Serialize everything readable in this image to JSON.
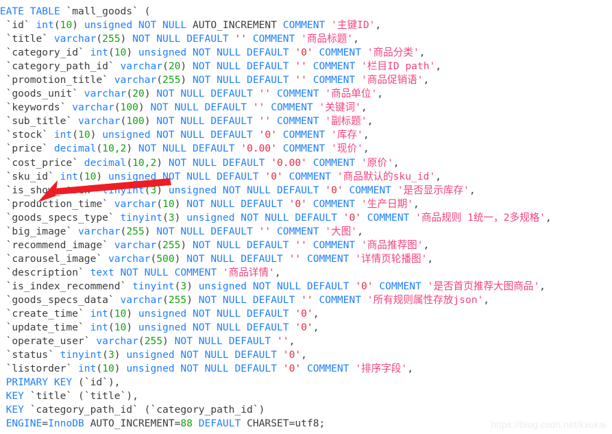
{
  "document": {
    "kind": "sql-create-table-dump",
    "table_name": "mall_goods",
    "watermark": "https://blog.csdn.net/kxukai",
    "engine": "InnoDB",
    "auto_increment": "88",
    "charset": "utf8"
  },
  "colors": {
    "keyword": "#1f7ffd",
    "identifier": "#3c3c3c",
    "number": "#13a10e",
    "string": "#e8283f",
    "comment_string": "#f4437d",
    "annotation_arrow": "#ee1c25",
    "background": "#ffffff",
    "watermark": "#ededed"
  },
  "annotation": {
    "type": "arrow",
    "points_at": "sku_id",
    "color": "#ee1c25"
  },
  "lines": [
    [
      {
        "t": "REATE TABLE ",
        "c": "kw"
      },
      {
        "t": "`mall_goods`",
        "c": "id"
      },
      {
        "t": " (",
        "c": "punc"
      }
    ],
    [
      {
        "t": "  `id`",
        "c": "id"
      },
      {
        "t": " int",
        "c": "typ"
      },
      {
        "t": "(",
        "c": "punc"
      },
      {
        "t": "10",
        "c": "num"
      },
      {
        "t": ")",
        "c": "punc"
      },
      {
        "t": " unsigned NOT NULL ",
        "c": "kw"
      },
      {
        "t": "AUTO_INCREMENT",
        "c": "plain"
      },
      {
        "t": " COMMENT ",
        "c": "kw"
      },
      {
        "t": "'主键ID'",
        "c": "cmt"
      },
      {
        "t": ",",
        "c": "punc"
      }
    ],
    [
      {
        "t": "  `title`",
        "c": "id"
      },
      {
        "t": " varchar",
        "c": "typ"
      },
      {
        "t": "(",
        "c": "punc"
      },
      {
        "t": "255",
        "c": "num"
      },
      {
        "t": ")",
        "c": "punc"
      },
      {
        "t": " NOT NULL DEFAULT ",
        "c": "kw"
      },
      {
        "t": "''",
        "c": "str"
      },
      {
        "t": " COMMENT ",
        "c": "kw"
      },
      {
        "t": "'商品标题'",
        "c": "cmt"
      },
      {
        "t": ",",
        "c": "punc"
      }
    ],
    [
      {
        "t": "  `category_id`",
        "c": "id"
      },
      {
        "t": " int",
        "c": "typ"
      },
      {
        "t": "(",
        "c": "punc"
      },
      {
        "t": "10",
        "c": "num"
      },
      {
        "t": ")",
        "c": "punc"
      },
      {
        "t": " unsigned NOT NULL DEFAULT ",
        "c": "kw"
      },
      {
        "t": "'0'",
        "c": "str"
      },
      {
        "t": " COMMENT ",
        "c": "kw"
      },
      {
        "t": "'商品分类'",
        "c": "cmt"
      },
      {
        "t": ",",
        "c": "punc"
      }
    ],
    [
      {
        "t": "  `category_path_id`",
        "c": "id"
      },
      {
        "t": " varchar",
        "c": "typ"
      },
      {
        "t": "(",
        "c": "punc"
      },
      {
        "t": "20",
        "c": "num"
      },
      {
        "t": ")",
        "c": "punc"
      },
      {
        "t": " NOT NULL DEFAULT ",
        "c": "kw"
      },
      {
        "t": "''",
        "c": "str"
      },
      {
        "t": " COMMENT ",
        "c": "kw"
      },
      {
        "t": "'栏目ID path'",
        "c": "cmt"
      },
      {
        "t": ",",
        "c": "punc"
      }
    ],
    [
      {
        "t": "  `promotion_title`",
        "c": "id"
      },
      {
        "t": " varchar",
        "c": "typ"
      },
      {
        "t": "(",
        "c": "punc"
      },
      {
        "t": "255",
        "c": "num"
      },
      {
        "t": ")",
        "c": "punc"
      },
      {
        "t": " NOT NULL DEFAULT ",
        "c": "kw"
      },
      {
        "t": "''",
        "c": "str"
      },
      {
        "t": " COMMENT ",
        "c": "kw"
      },
      {
        "t": "'商品促销语'",
        "c": "cmt"
      },
      {
        "t": ",",
        "c": "punc"
      }
    ],
    [
      {
        "t": "  `goods_unit`",
        "c": "id"
      },
      {
        "t": " varchar",
        "c": "typ"
      },
      {
        "t": "(",
        "c": "punc"
      },
      {
        "t": "20",
        "c": "num"
      },
      {
        "t": ")",
        "c": "punc"
      },
      {
        "t": " NOT NULL DEFAULT ",
        "c": "kw"
      },
      {
        "t": "''",
        "c": "str"
      },
      {
        "t": " COMMENT ",
        "c": "kw"
      },
      {
        "t": "'商品单位'",
        "c": "cmt"
      },
      {
        "t": ",",
        "c": "punc"
      }
    ],
    [
      {
        "t": "  `keywords`",
        "c": "id"
      },
      {
        "t": " varchar",
        "c": "typ"
      },
      {
        "t": "(",
        "c": "punc"
      },
      {
        "t": "100",
        "c": "num"
      },
      {
        "t": ")",
        "c": "punc"
      },
      {
        "t": " NOT NULL DEFAULT ",
        "c": "kw"
      },
      {
        "t": "''",
        "c": "str"
      },
      {
        "t": " COMMENT ",
        "c": "kw"
      },
      {
        "t": "'关键词'",
        "c": "cmt"
      },
      {
        "t": ",",
        "c": "punc"
      }
    ],
    [
      {
        "t": "  `sub_title`",
        "c": "id"
      },
      {
        "t": " varchar",
        "c": "typ"
      },
      {
        "t": "(",
        "c": "punc"
      },
      {
        "t": "100",
        "c": "num"
      },
      {
        "t": ")",
        "c": "punc"
      },
      {
        "t": " NOT NULL DEFAULT ",
        "c": "kw"
      },
      {
        "t": "''",
        "c": "str"
      },
      {
        "t": " COMMENT ",
        "c": "kw"
      },
      {
        "t": "'副标题'",
        "c": "cmt"
      },
      {
        "t": ",",
        "c": "punc"
      }
    ],
    [
      {
        "t": "  `stock`",
        "c": "id"
      },
      {
        "t": " int",
        "c": "typ"
      },
      {
        "t": "(",
        "c": "punc"
      },
      {
        "t": "10",
        "c": "num"
      },
      {
        "t": ")",
        "c": "punc"
      },
      {
        "t": " unsigned NOT NULL DEFAULT ",
        "c": "kw"
      },
      {
        "t": "'0'",
        "c": "str"
      },
      {
        "t": " COMMENT ",
        "c": "kw"
      },
      {
        "t": "'库存'",
        "c": "cmt"
      },
      {
        "t": ",",
        "c": "punc"
      }
    ],
    [
      {
        "t": "  `price`",
        "c": "id"
      },
      {
        "t": " decimal",
        "c": "typ"
      },
      {
        "t": "(",
        "c": "punc"
      },
      {
        "t": "10,2",
        "c": "num"
      },
      {
        "t": ")",
        "c": "punc"
      },
      {
        "t": " NOT NULL DEFAULT ",
        "c": "kw"
      },
      {
        "t": "'0.00'",
        "c": "str"
      },
      {
        "t": " COMMENT ",
        "c": "kw"
      },
      {
        "t": "'现价'",
        "c": "cmt"
      },
      {
        "t": ",",
        "c": "punc"
      }
    ],
    [
      {
        "t": "  `cost_price`",
        "c": "id"
      },
      {
        "t": " decimal",
        "c": "typ"
      },
      {
        "t": "(",
        "c": "punc"
      },
      {
        "t": "10,2",
        "c": "num"
      },
      {
        "t": ")",
        "c": "punc"
      },
      {
        "t": " NOT NULL DEFAULT ",
        "c": "kw"
      },
      {
        "t": "'0.00'",
        "c": "str"
      },
      {
        "t": " COMMENT ",
        "c": "kw"
      },
      {
        "t": "'原价'",
        "c": "cmt"
      },
      {
        "t": ",",
        "c": "punc"
      }
    ],
    [
      {
        "t": "  `sku_id`",
        "c": "id"
      },
      {
        "t": " int",
        "c": "typ"
      },
      {
        "t": "(",
        "c": "punc"
      },
      {
        "t": "10",
        "c": "num"
      },
      {
        "t": ")",
        "c": "punc"
      },
      {
        "t": " unsigned NOT NULL DEFAULT ",
        "c": "kw"
      },
      {
        "t": "'0'",
        "c": "str"
      },
      {
        "t": " COMMENT ",
        "c": "kw"
      },
      {
        "t": "'商品默认的sku_id'",
        "c": "cmt"
      },
      {
        "t": ",",
        "c": "punc"
      }
    ],
    [
      {
        "t": "  `is_show_stock`",
        "c": "id"
      },
      {
        "t": " tinyint",
        "c": "typ"
      },
      {
        "t": "(",
        "c": "punc"
      },
      {
        "t": "3",
        "c": "num"
      },
      {
        "t": ")",
        "c": "punc"
      },
      {
        "t": " unsigned NOT NULL DEFAULT ",
        "c": "kw"
      },
      {
        "t": "'0'",
        "c": "str"
      },
      {
        "t": " COMMENT ",
        "c": "kw"
      },
      {
        "t": "'是否显示库存'",
        "c": "cmt"
      },
      {
        "t": ",",
        "c": "punc"
      }
    ],
    [
      {
        "t": "  `production_time`",
        "c": "id"
      },
      {
        "t": " varchar",
        "c": "typ"
      },
      {
        "t": "(",
        "c": "punc"
      },
      {
        "t": "10",
        "c": "num"
      },
      {
        "t": ")",
        "c": "punc"
      },
      {
        "t": " NOT NULL DEFAULT ",
        "c": "kw"
      },
      {
        "t": "'0'",
        "c": "str"
      },
      {
        "t": " COMMENT ",
        "c": "kw"
      },
      {
        "t": "'生产日期'",
        "c": "cmt"
      },
      {
        "t": ",",
        "c": "punc"
      }
    ],
    [
      {
        "t": "  `goods_specs_type`",
        "c": "id"
      },
      {
        "t": " tinyint",
        "c": "typ"
      },
      {
        "t": "(",
        "c": "punc"
      },
      {
        "t": "3",
        "c": "num"
      },
      {
        "t": ")",
        "c": "punc"
      },
      {
        "t": " unsigned NOT NULL DEFAULT ",
        "c": "kw"
      },
      {
        "t": "'0'",
        "c": "str"
      },
      {
        "t": " COMMENT ",
        "c": "kw"
      },
      {
        "t": "'商品规则 1统一，2多规格'",
        "c": "cmt"
      },
      {
        "t": ",",
        "c": "punc"
      }
    ],
    [
      {
        "t": "  `big_image`",
        "c": "id"
      },
      {
        "t": " varchar",
        "c": "typ"
      },
      {
        "t": "(",
        "c": "punc"
      },
      {
        "t": "255",
        "c": "num"
      },
      {
        "t": ")",
        "c": "punc"
      },
      {
        "t": " NOT NULL DEFAULT ",
        "c": "kw"
      },
      {
        "t": "''",
        "c": "str"
      },
      {
        "t": " COMMENT ",
        "c": "kw"
      },
      {
        "t": "'大图'",
        "c": "cmt"
      },
      {
        "t": ",",
        "c": "punc"
      }
    ],
    [
      {
        "t": "  `recommend_image`",
        "c": "id"
      },
      {
        "t": " varchar",
        "c": "typ"
      },
      {
        "t": "(",
        "c": "punc"
      },
      {
        "t": "255",
        "c": "num"
      },
      {
        "t": ")",
        "c": "punc"
      },
      {
        "t": " NOT NULL DEFAULT ",
        "c": "kw"
      },
      {
        "t": "''",
        "c": "str"
      },
      {
        "t": " COMMENT ",
        "c": "kw"
      },
      {
        "t": "'商品推荐图'",
        "c": "cmt"
      },
      {
        "t": ",",
        "c": "punc"
      }
    ],
    [
      {
        "t": "  `carousel_image`",
        "c": "id"
      },
      {
        "t": " varchar",
        "c": "typ"
      },
      {
        "t": "(",
        "c": "punc"
      },
      {
        "t": "500",
        "c": "num"
      },
      {
        "t": ")",
        "c": "punc"
      },
      {
        "t": " NOT NULL DEFAULT ",
        "c": "kw"
      },
      {
        "t": "''",
        "c": "str"
      },
      {
        "t": " COMMENT ",
        "c": "kw"
      },
      {
        "t": "'详情页轮播图'",
        "c": "cmt"
      },
      {
        "t": ",",
        "c": "punc"
      }
    ],
    [
      {
        "t": "  `description`",
        "c": "id"
      },
      {
        "t": " text",
        "c": "typ"
      },
      {
        "t": " NOT NULL COMMENT ",
        "c": "kw"
      },
      {
        "t": "'商品详情'",
        "c": "cmt"
      },
      {
        "t": ",",
        "c": "punc"
      }
    ],
    [
      {
        "t": "  `is_index_recommend`",
        "c": "id"
      },
      {
        "t": " tinyint",
        "c": "typ"
      },
      {
        "t": "(",
        "c": "punc"
      },
      {
        "t": "3",
        "c": "num"
      },
      {
        "t": ")",
        "c": "punc"
      },
      {
        "t": " unsigned NOT NULL DEFAULT ",
        "c": "kw"
      },
      {
        "t": "'0'",
        "c": "str"
      },
      {
        "t": " COMMENT ",
        "c": "kw"
      },
      {
        "t": "'是否首页推荐大图商品'",
        "c": "cmt"
      },
      {
        "t": ",",
        "c": "punc"
      }
    ],
    [
      {
        "t": "  `goods_specs_data`",
        "c": "id"
      },
      {
        "t": " varchar",
        "c": "typ"
      },
      {
        "t": "(",
        "c": "punc"
      },
      {
        "t": "255",
        "c": "num"
      },
      {
        "t": ")",
        "c": "punc"
      },
      {
        "t": " NOT NULL DEFAULT ",
        "c": "kw"
      },
      {
        "t": "''",
        "c": "str"
      },
      {
        "t": " COMMENT ",
        "c": "kw"
      },
      {
        "t": "'所有规则属性存放json'",
        "c": "cmt"
      },
      {
        "t": ",",
        "c": "punc"
      }
    ],
    [
      {
        "t": "  `create_time`",
        "c": "id"
      },
      {
        "t": " int",
        "c": "typ"
      },
      {
        "t": "(",
        "c": "punc"
      },
      {
        "t": "10",
        "c": "num"
      },
      {
        "t": ")",
        "c": "punc"
      },
      {
        "t": " unsigned NOT NULL DEFAULT ",
        "c": "kw"
      },
      {
        "t": "'0'",
        "c": "str"
      },
      {
        "t": ",",
        "c": "punc"
      }
    ],
    [
      {
        "t": "  `update_time`",
        "c": "id"
      },
      {
        "t": " int",
        "c": "typ"
      },
      {
        "t": "(",
        "c": "punc"
      },
      {
        "t": "10",
        "c": "num"
      },
      {
        "t": ")",
        "c": "punc"
      },
      {
        "t": " unsigned NOT NULL DEFAULT ",
        "c": "kw"
      },
      {
        "t": "'0'",
        "c": "str"
      },
      {
        "t": ",",
        "c": "punc"
      }
    ],
    [
      {
        "t": "  `operate_user`",
        "c": "id"
      },
      {
        "t": " varchar",
        "c": "typ"
      },
      {
        "t": "(",
        "c": "punc"
      },
      {
        "t": "255",
        "c": "num"
      },
      {
        "t": ")",
        "c": "punc"
      },
      {
        "t": " NOT NULL DEFAULT ",
        "c": "kw"
      },
      {
        "t": "''",
        "c": "str"
      },
      {
        "t": ",",
        "c": "punc"
      }
    ],
    [
      {
        "t": "  `status`",
        "c": "id"
      },
      {
        "t": " tinyint",
        "c": "typ"
      },
      {
        "t": "(",
        "c": "punc"
      },
      {
        "t": "3",
        "c": "num"
      },
      {
        "t": ")",
        "c": "punc"
      },
      {
        "t": " unsigned NOT NULL DEFAULT ",
        "c": "kw"
      },
      {
        "t": "'0'",
        "c": "str"
      },
      {
        "t": ",",
        "c": "punc"
      }
    ],
    [
      {
        "t": "  `listorder`",
        "c": "id"
      },
      {
        "t": " int",
        "c": "typ"
      },
      {
        "t": "(",
        "c": "punc"
      },
      {
        "t": "10",
        "c": "num"
      },
      {
        "t": ")",
        "c": "punc"
      },
      {
        "t": " unsigned NOT NULL DEFAULT ",
        "c": "kw"
      },
      {
        "t": "'0'",
        "c": "str"
      },
      {
        "t": " COMMENT ",
        "c": "kw"
      },
      {
        "t": "'排序字段'",
        "c": "cmt"
      },
      {
        "t": ",",
        "c": "punc"
      }
    ],
    [
      {
        "t": "  PRIMARY KEY ",
        "c": "kw"
      },
      {
        "t": "(",
        "c": "punc"
      },
      {
        "t": "`id`",
        "c": "id"
      },
      {
        "t": "),",
        "c": "punc"
      }
    ],
    [
      {
        "t": "  KEY ",
        "c": "kw"
      },
      {
        "t": "`title`",
        "c": "id"
      },
      {
        "t": " (",
        "c": "punc"
      },
      {
        "t": "`title`",
        "c": "id"
      },
      {
        "t": "),",
        "c": "punc"
      }
    ],
    [
      {
        "t": "  KEY ",
        "c": "kw"
      },
      {
        "t": "`category_path_id`",
        "c": "id"
      },
      {
        "t": " (",
        "c": "punc"
      },
      {
        "t": "`category_path_id`",
        "c": "id"
      },
      {
        "t": ")",
        "c": "punc"
      }
    ],
    [
      {
        "t": "  ENGINE",
        "c": "kw"
      },
      {
        "t": "=",
        "c": "punc"
      },
      {
        "t": "InnoDB",
        "c": "kw"
      },
      {
        "t": " AUTO_INCREMENT=",
        "c": "plain"
      },
      {
        "t": "88",
        "c": "num"
      },
      {
        "t": " DEFAULT ",
        "c": "kw"
      },
      {
        "t": "CHARSET=utf8;",
        "c": "plain"
      }
    ]
  ]
}
